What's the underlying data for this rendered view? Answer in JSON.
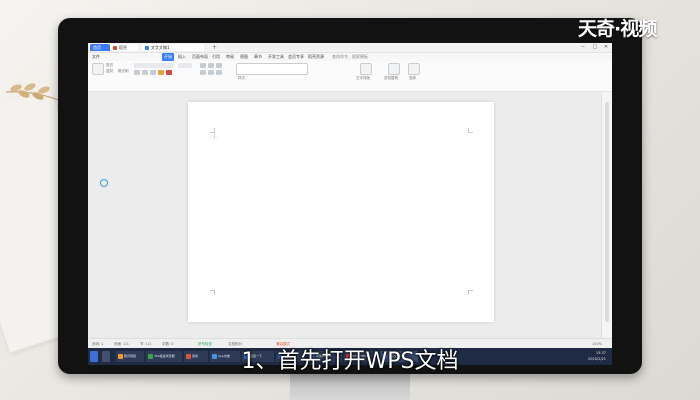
{
  "titlebar": {
    "home_tab": "首页",
    "doc_tab": "稻壳",
    "active_tab": "文字文稿1",
    "new_tab_symbol": "+",
    "controls": [
      "─",
      "□",
      "✕"
    ]
  },
  "menubar": {
    "file": "文件",
    "items": [
      "开始",
      "插入",
      "页面布局",
      "引用",
      "审阅",
      "视图",
      "章节",
      "开发工具",
      "会员专享",
      "稻壳资源"
    ],
    "selected": "开始",
    "search_placeholder": "查找命令、搜索模板"
  },
  "ribbon": {
    "labels": [
      "剪切",
      "复制",
      "格式刷",
      "样式",
      "文字排版",
      "查找替换",
      "选择"
    ]
  },
  "page": {
    "cursor_text": "|.."
  },
  "statusbar": {
    "page": "页码: 1",
    "pages": "页面: 1/1",
    "section": "节: 1/1",
    "words": "字数: 0",
    "spell": "拼写检查",
    "docfix": "文档校对",
    "compat": "兼容模式",
    "zoom": "100%"
  },
  "taskbar": {
    "apps": [
      "腾讯视频",
      "360极速浏览器",
      "我的",
      "App内嵌",
      "百度一下",
      "Word",
      "新建DOCX",
      "WPS Office",
      "文字文稿1"
    ],
    "time": "15:37",
    "date": "2020/2/21"
  },
  "overlay": {
    "watermark": "天奇·视频",
    "subtitle": "1、首先打开WPS文档"
  },
  "colors": {
    "accent": "#3b7cf4",
    "taskbar": "#1f2a44",
    "bezel": "#121212"
  }
}
